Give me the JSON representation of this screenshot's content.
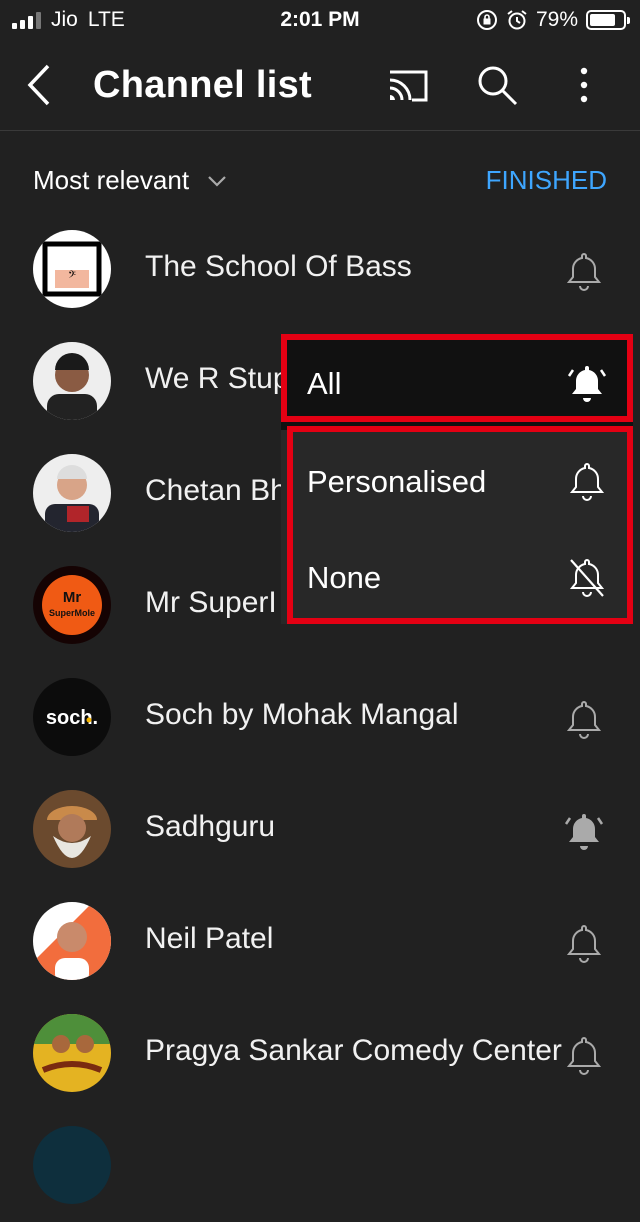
{
  "status_bar": {
    "carrier": "Jio",
    "network": "LTE",
    "time": "2:01 PM",
    "battery": "79%",
    "battery_level": 0.79
  },
  "header": {
    "title": "Channel list"
  },
  "sort": {
    "label": "Most relevant",
    "finished": "FINISHED"
  },
  "channels": [
    {
      "name": "The School Of Bass",
      "bell": "bell-outline",
      "avatar_text": "THE SCHOOL OF BASS"
    },
    {
      "name": "We R Stup",
      "bell": "hidden",
      "avatar_text": ""
    },
    {
      "name": "Chetan Bh",
      "bell": "hidden",
      "avatar_text": ""
    },
    {
      "name": "Mr SuperI",
      "bell": "hidden",
      "avatar_text": "Mr SuperMole"
    },
    {
      "name": "Soch by Mohak Mangal",
      "bell": "bell-outline",
      "avatar_text": "soch."
    },
    {
      "name": "Sadhguru",
      "bell": "bell-ringing",
      "avatar_text": ""
    },
    {
      "name": "Neil Patel",
      "bell": "bell-outline",
      "avatar_text": ""
    },
    {
      "name": "Pragya Sankar Comedy Center",
      "bell": "bell-outline",
      "avatar_text": ""
    }
  ],
  "popup": {
    "options": [
      {
        "label": "All",
        "icon": "bell-ringing-icon"
      },
      {
        "label": "Personalised",
        "icon": "bell-icon"
      },
      {
        "label": "None",
        "icon": "bell-off-icon"
      }
    ]
  },
  "colors": {
    "background": "#212121",
    "accent": "#3ea6ff",
    "highlight": "#e40013"
  }
}
